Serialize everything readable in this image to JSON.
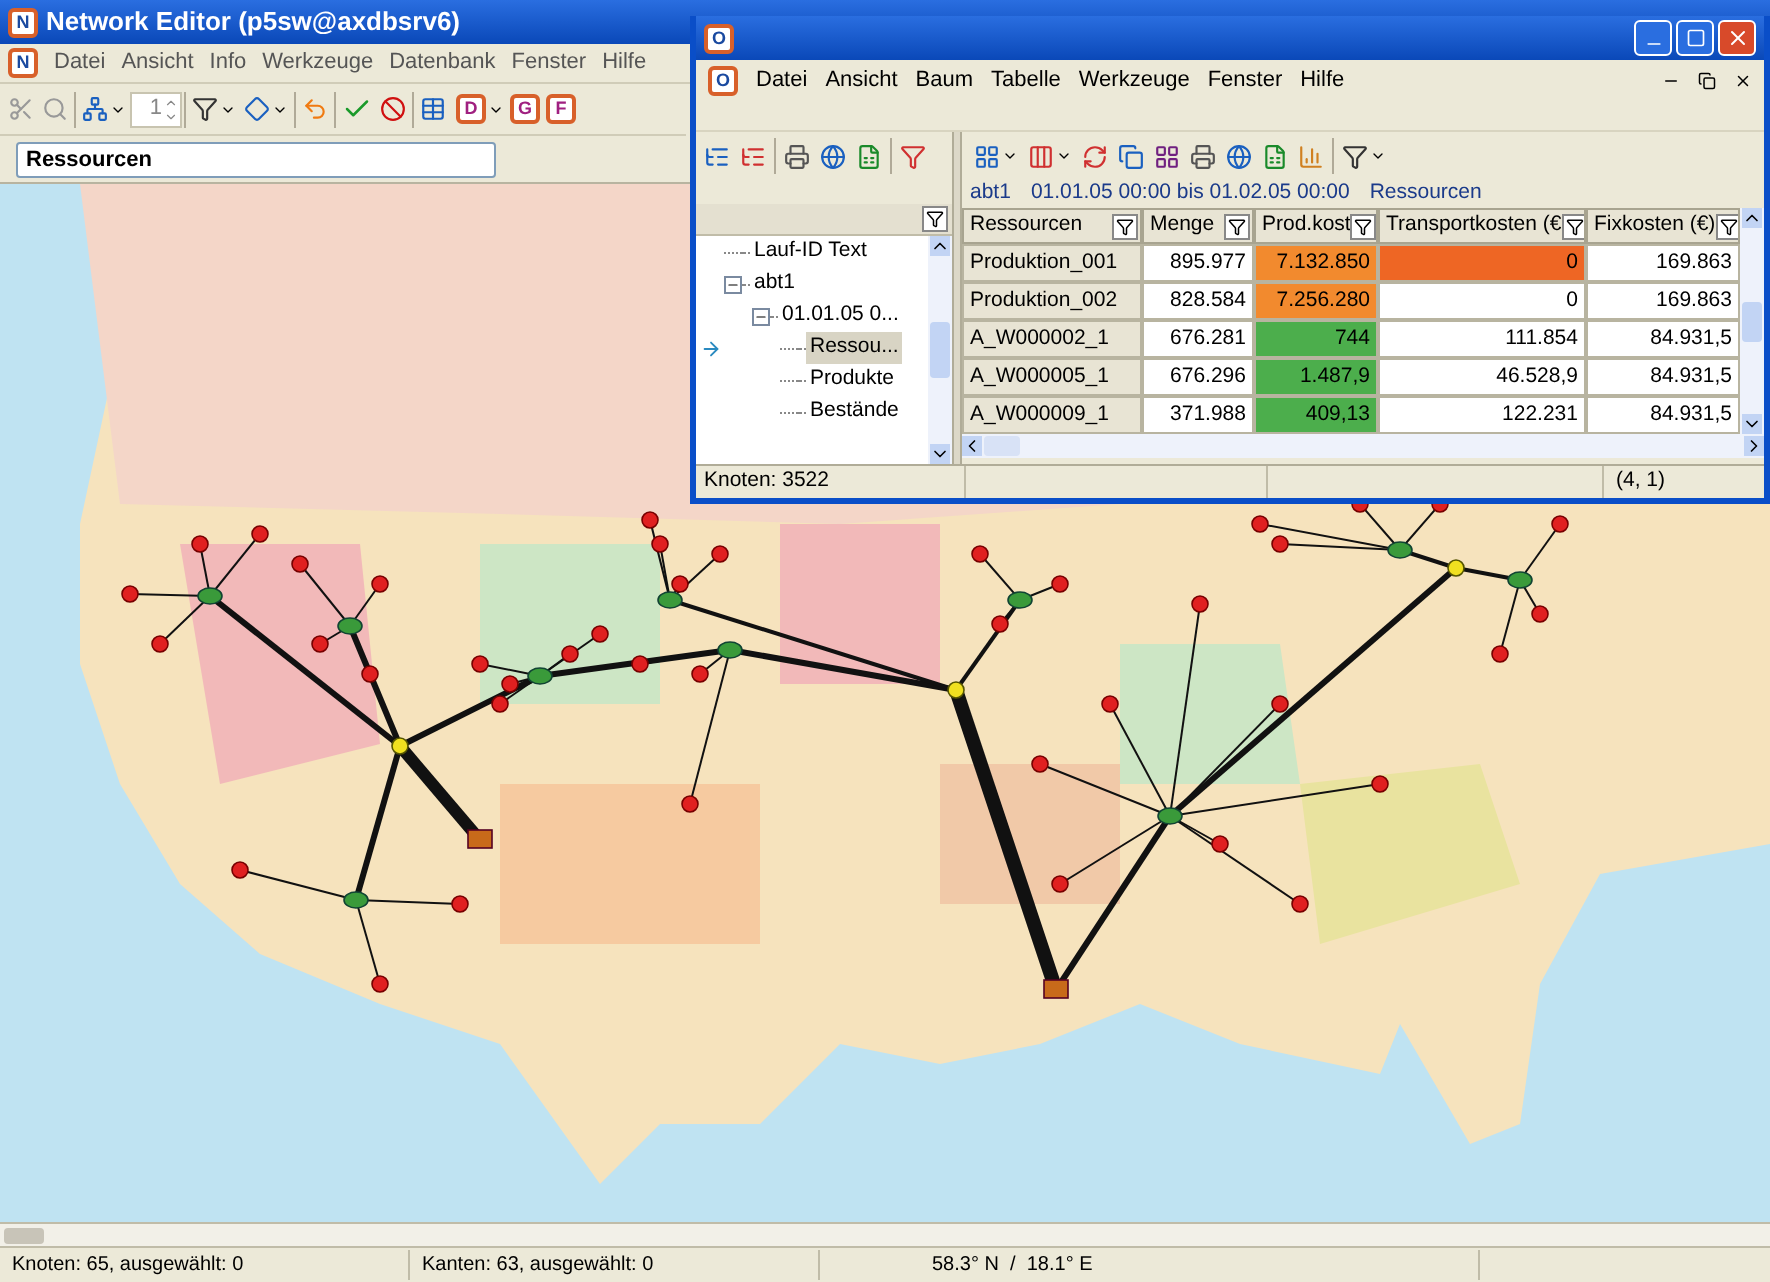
{
  "main_window": {
    "logo": "N",
    "title": "Network Editor (p5sw@axdbsrv6)",
    "menu_logo": "N",
    "menu": [
      "Datei",
      "Ansicht",
      "Info",
      "Werkzeuge",
      "Datenbank",
      "Fenster",
      "Hilfe"
    ],
    "toolbar": {
      "spin_value": "1",
      "letter_buttons": [
        "D",
        "G",
        "F"
      ]
    },
    "layer_field": {
      "value": "Ressourcen"
    },
    "status_bar": [
      "Knoten: 65, ausgewählt: 0",
      "Kanten: 63, ausgewählt: 0",
      "58.3° N  /  18.1° E"
    ]
  },
  "table_window": {
    "logo": "O",
    "menu_logo": "O",
    "menu": [
      "Datei",
      "Ansicht",
      "Baum",
      "Tabelle",
      "Werkzeuge",
      "Fenster",
      "Hilfe"
    ],
    "info": [
      "abt1",
      "01.01.05 00:00 bis 01.02.05 00:00",
      "Ressourcen"
    ],
    "tree": [
      {
        "label": "Lauf-ID Text",
        "selected": false
      },
      {
        "label": "abt1",
        "selected": false,
        "expanded": true,
        "children": [
          {
            "label": "01.01.05 0...",
            "selected": false,
            "expanded": true,
            "children": [
              {
                "label": "Ressou...",
                "selected": true
              },
              {
                "label": "Produkte",
                "selected": false
              },
              {
                "label": "Bestände",
                "selected": false
              }
            ]
          }
        ]
      }
    ],
    "table": {
      "columns": [
        "Ressourcen",
        "Menge",
        "Prod.kost",
        "Transportkosten (€",
        "Fixkosten (€)"
      ],
      "rows": [
        {
          "cells": [
            {
              "text": "Produktion_001"
            },
            {
              "text": "895.977"
            },
            {
              "text": "7.132.850",
              "color": "#f28a2e"
            },
            {
              "text": "0",
              "color": "#ee6624"
            },
            {
              "text": "169.863"
            }
          ]
        },
        {
          "cells": [
            {
              "text": "Produktion_002"
            },
            {
              "text": "828.584"
            },
            {
              "text": "7.256.280",
              "color": "#f28a2e"
            },
            {
              "text": "0"
            },
            {
              "text": "169.863"
            }
          ]
        },
        {
          "cells": [
            {
              "text": "A_W000002_1"
            },
            {
              "text": "676.281"
            },
            {
              "text": "744",
              "color": "#4cae4c"
            },
            {
              "text": "111.854"
            },
            {
              "text": "84.931,5"
            }
          ]
        },
        {
          "cells": [
            {
              "text": "A_W000005_1"
            },
            {
              "text": "676.296"
            },
            {
              "text": "1.487,9",
              "color": "#4cae4c"
            },
            {
              "text": "46.528,9"
            },
            {
              "text": "84.931,5"
            }
          ]
        },
        {
          "cells": [
            {
              "text": "A_W000009_1"
            },
            {
              "text": "371.988"
            },
            {
              "text": "409,13",
              "color": "#4cae4c"
            },
            {
              "text": "122.231"
            },
            {
              "text": "84.931,5"
            }
          ]
        }
      ]
    },
    "status": {
      "nodes": "Knoten: 3522",
      "position": "(4, 1)"
    }
  }
}
